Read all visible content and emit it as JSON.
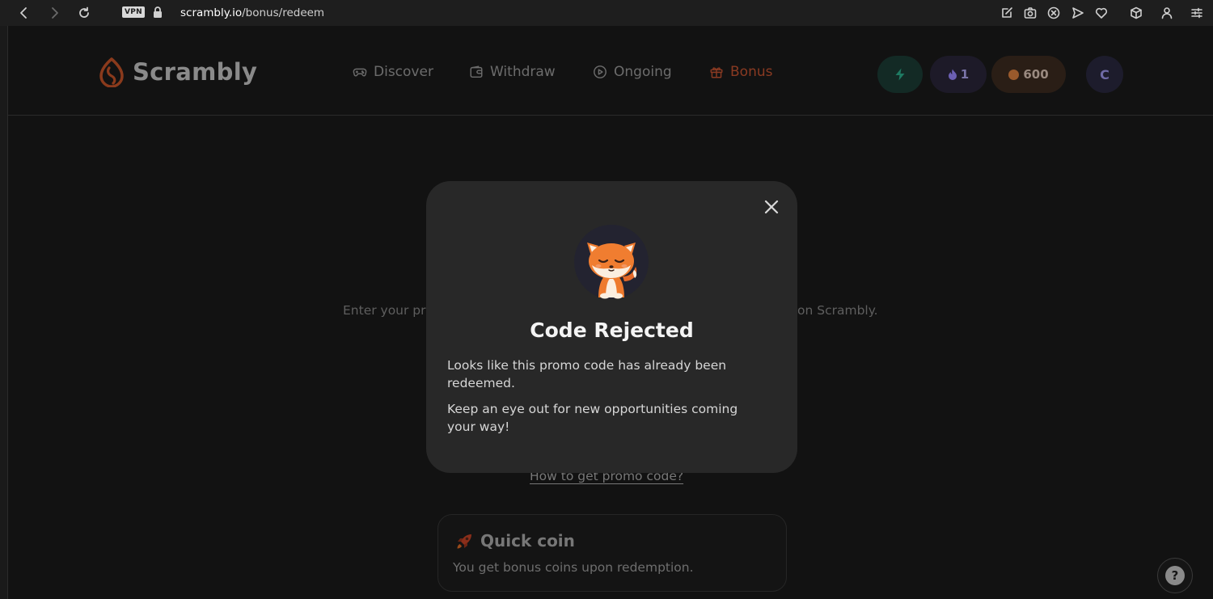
{
  "browser": {
    "vpn_label": "VPN",
    "url_host": "scrambly.io",
    "url_path": "/bonus/redeem"
  },
  "site": {
    "logo_text": "Scrambly",
    "nav": [
      {
        "label": "Discover",
        "icon": "gamepad-icon"
      },
      {
        "label": "Withdraw",
        "icon": "wallet-icon"
      },
      {
        "label": "Ongoing",
        "icon": "play-circle-icon"
      },
      {
        "label": "Bonus",
        "icon": "gift-icon",
        "active": true
      }
    ],
    "streak_count": "1",
    "coin_balance": "600",
    "avatar_initial": "C",
    "colors": {
      "accent": "#e0572a",
      "bolt": "#2fd3a2",
      "streak": "#7a6cf0",
      "coin": "#e08a3c"
    }
  },
  "page": {
    "intro_left": "Enter your pr",
    "intro_right": "on Scrambly.",
    "howto_link": "How to get promo code?",
    "quick_card": {
      "title": "Quick coin",
      "description": "You get bonus coins upon redemption."
    },
    "help_label": "?"
  },
  "modal": {
    "title": "Code Rejected",
    "paragraph1": "Looks like this promo code has already been redeemed.",
    "paragraph2": "Keep an eye out for new opportunities coming your way!"
  }
}
